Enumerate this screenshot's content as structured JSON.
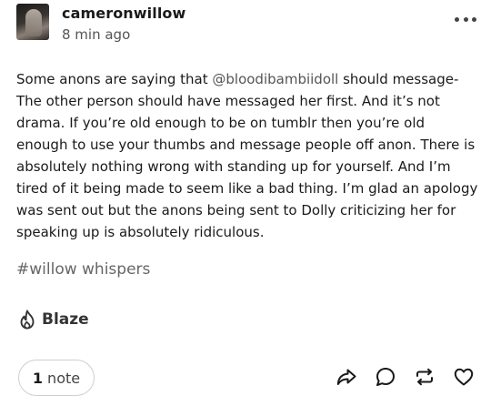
{
  "post": {
    "username": "cameronwillow",
    "timestamp": "8 min ago",
    "text_before_mention": "Some anons are saying that ",
    "mention": "@bloodibambiidoll",
    "text_after_mention": " should message-The other person should have messaged her first. And it’s not drama. If you’re old enough to be on tumblr then you’re old enough to use your thumbs and message people off anon. There is absolutely nothing wrong with standing up for yourself. And I’m tired of it being made to seem like a bad thing. I’m glad an apology was sent out but the anons being sent to Dolly criticizing her for speaking up is absolutely ridiculous.",
    "tag": "#willow whispers"
  },
  "blaze": {
    "label": "Blaze",
    "icon": "flame-icon"
  },
  "footer": {
    "notes_count": "1",
    "notes_word": "note",
    "action_icons": [
      "share-icon",
      "reply-icon",
      "reblog-icon",
      "like-icon"
    ]
  }
}
